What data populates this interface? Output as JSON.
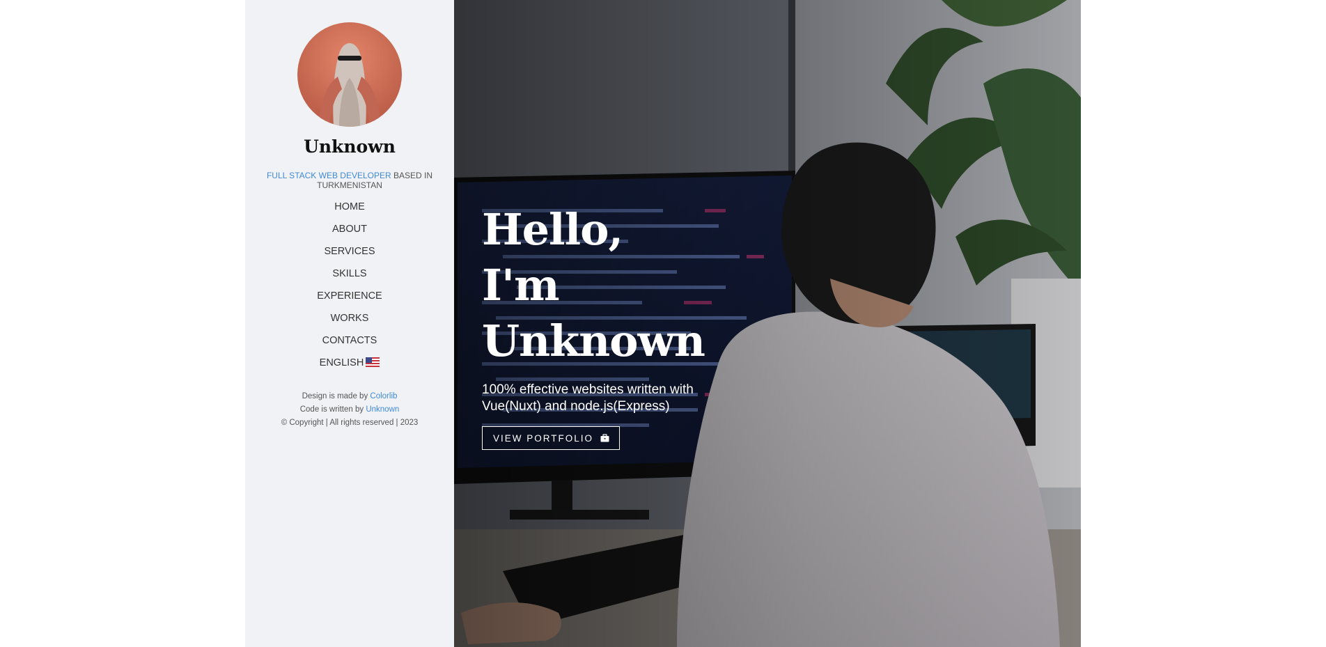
{
  "profile": {
    "name": "Unknown",
    "tagline_role": "FULL STACK WEB DEVELOPER",
    "tagline_rest": "BASED IN TURKMENISTAN"
  },
  "nav": {
    "home": "HOME",
    "about": "ABOUT",
    "services": "SERVICES",
    "skills": "SKILLS",
    "experience": "EXPERIENCE",
    "works": "WORKS",
    "contacts": "CONTACTS",
    "language": "ENGLISH"
  },
  "credits": {
    "design_prefix": "Design is made by",
    "design_link": "Colorlib",
    "code_prefix": "Code is written by",
    "code_link": "Unknown",
    "copyright": "© Copyright | All rights reserved | 2023"
  },
  "hero": {
    "line1": "Hello,",
    "line2": "I'm",
    "line3": "Unknown",
    "subtitle_line1": "100% effective websites written with",
    "subtitle_line2": "Vue(Nuxt) and node.js(Express)",
    "button_label": "VIEW PORTFOLIO"
  },
  "colors": {
    "sidebar_bg": "#f1f2f6",
    "accent": "#3f8ad6",
    "hero_text": "#ffffff"
  },
  "icons": {
    "language_flag": "us-flag-icon",
    "portfolio": "briefcase-icon"
  }
}
